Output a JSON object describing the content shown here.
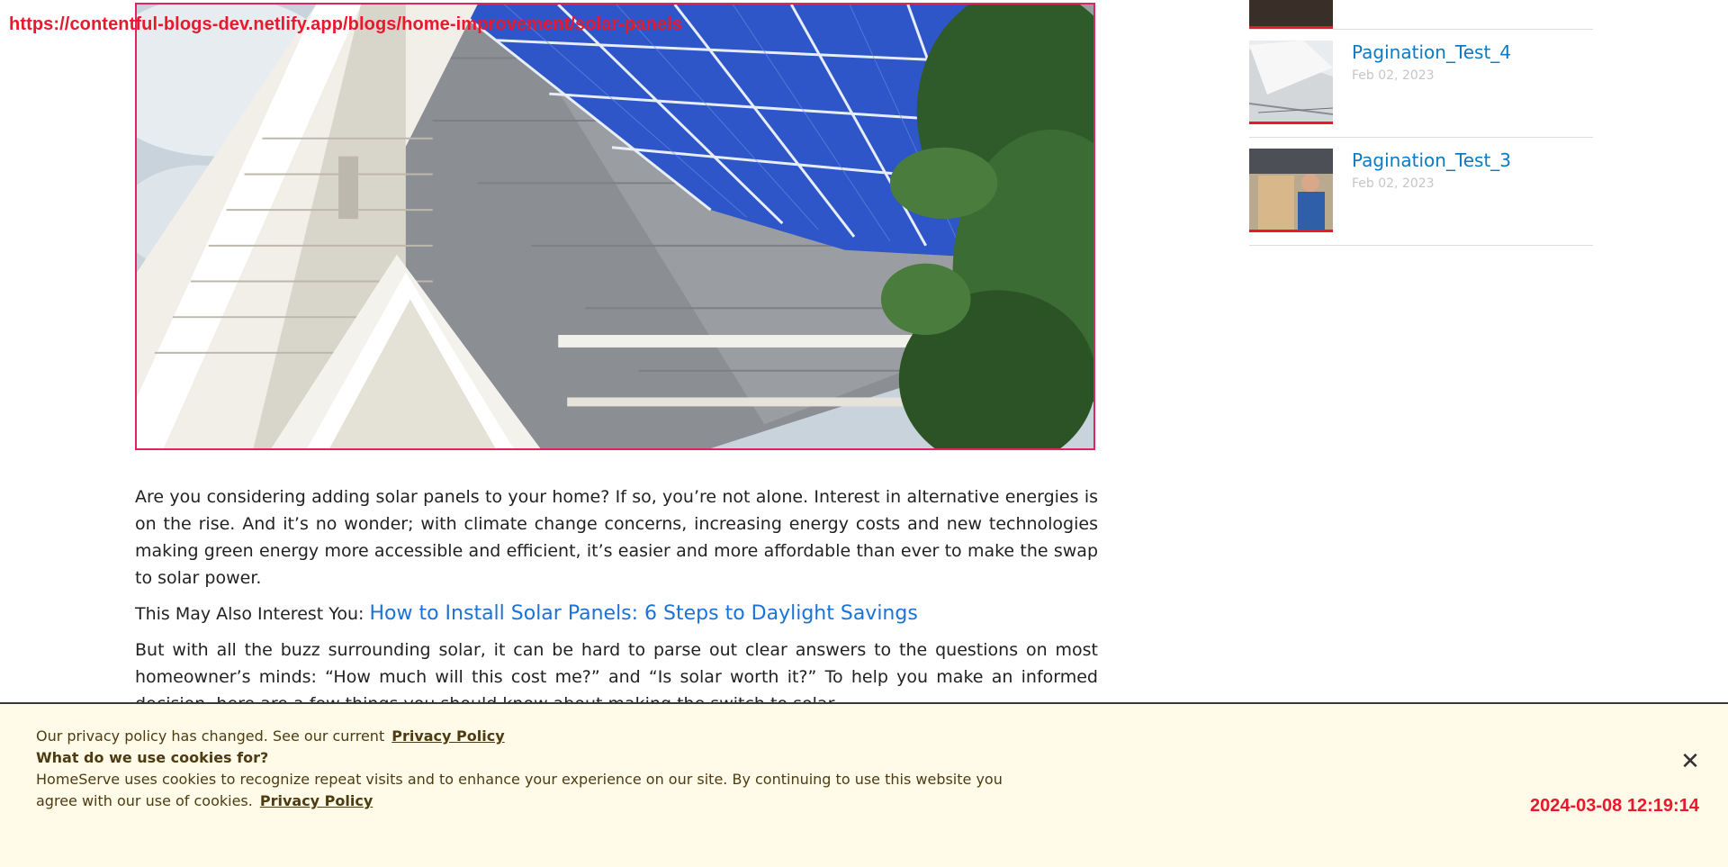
{
  "url_overlay": "https://contentful-blogs-dev.netlify.app/blogs/home-improvement/solar-panels",
  "timestamp_overlay": "2024-03-08 12:19:14",
  "article": {
    "paragraph_1": "Are you considering adding solar panels to your home? If so, you’re not alone. Interest in alternative energies is on the rise. And it’s no wonder; with climate change concerns, increasing energy costs and new technologies making green energy more accessible and efficient, it’s easier and more affordable than ever to make the swap to solar power.",
    "interest_label": "This May Also Interest You:",
    "interest_link": "How to Install Solar Panels: 6 Steps to Daylight Savings",
    "paragraph_2": "But with all the buzz surrounding solar, it can be hard to parse out clear answers to the questions on most homeowner’s minds: “How much will this cost me?” and “Is solar worth it?” To help you make an informed decision, here are a few things you should know about making the switch to solar."
  },
  "sidebar": {
    "items": [
      {
        "title": "Pagination_Test_4",
        "date": "Feb 02, 2023"
      },
      {
        "title": "Pagination_Test_3",
        "date": "Feb 02, 2023"
      }
    ]
  },
  "cookie_banner": {
    "line1": "Our privacy policy has changed. See our current",
    "line1_link": "Privacy Policy",
    "heading": "What do we use cookies for?",
    "body_line1": "HomeServe uses cookies to recognize repeat visits and to enhance your experience on our site. By continuing to use this website you",
    "body_line2": "agree with our use of cookies.",
    "body_link": "Privacy Policy",
    "close_label": "✕"
  },
  "colors": {
    "link": "#1a73d9",
    "sidebar_title": "#0a7bc2",
    "accent_red": "#e8192c",
    "cookie_bg": "#fffbe8"
  }
}
